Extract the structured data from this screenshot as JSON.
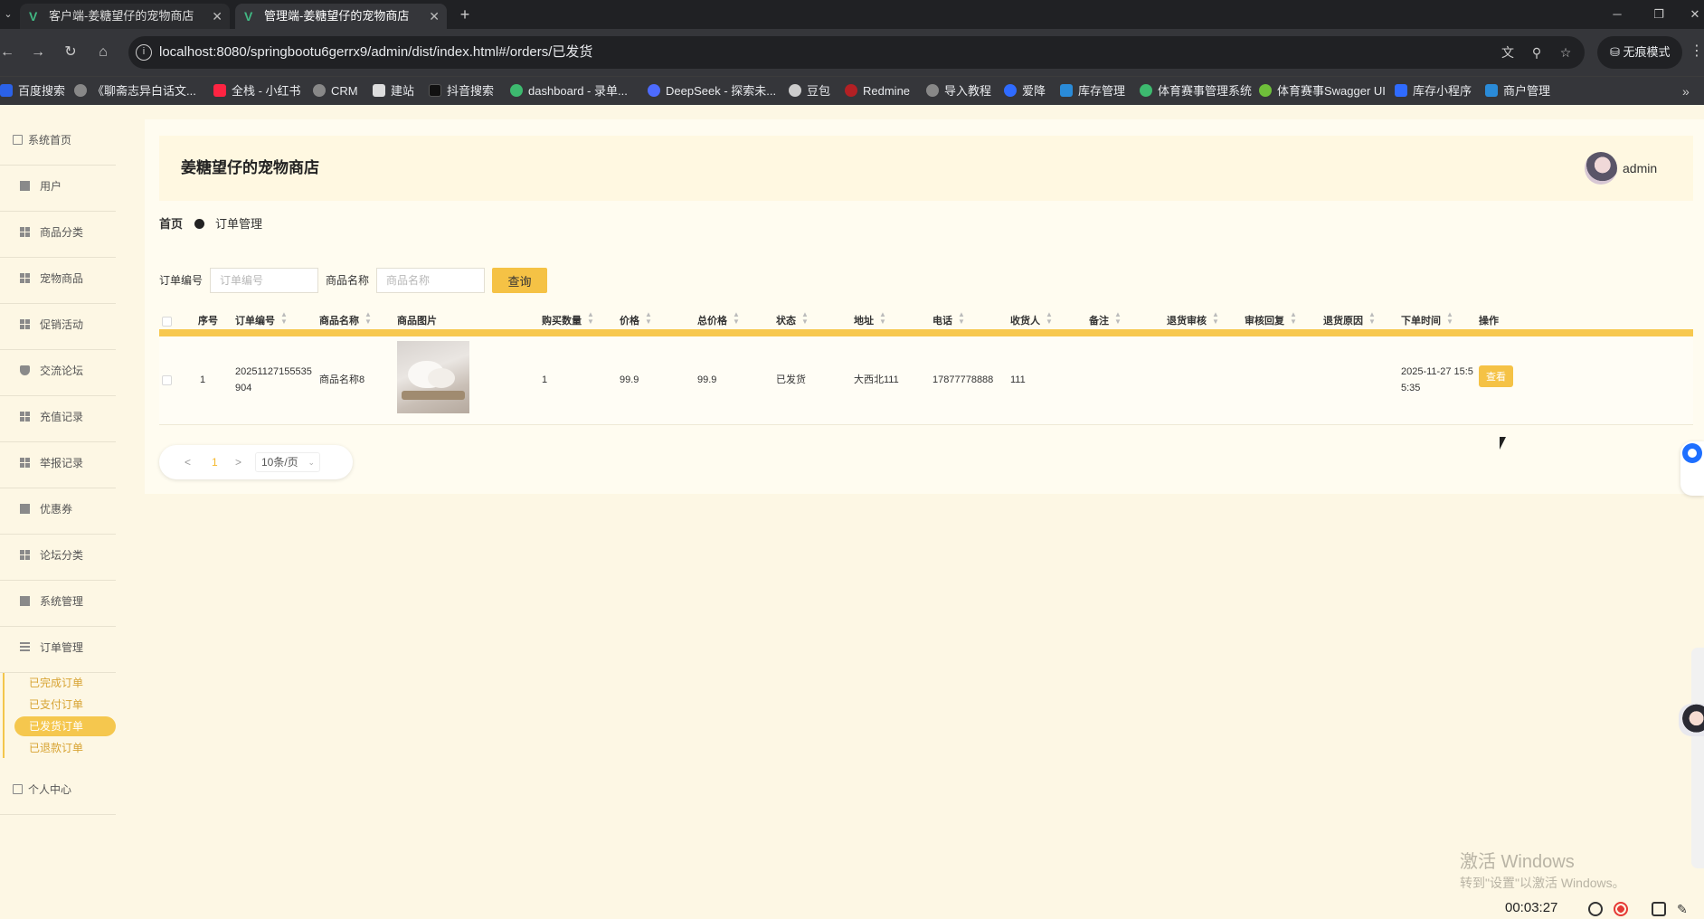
{
  "browser": {
    "tabs": [
      {
        "title": "客户端-姜糖望仔的宠物商店"
      },
      {
        "title": "管理端-姜糖望仔的宠物商店"
      }
    ],
    "url": "localhost:8080/springbootu6gerrx9/admin/dist/index.html#/orders/已发货",
    "incognito_label": "无痕模式",
    "bookmarks": [
      "百度搜索",
      "《聊斋志异白话文...",
      "全栈 - 小红书",
      "CRM",
      "建站",
      "抖音搜索",
      "dashboard - 录单...",
      "DeepSeek - 探索未...",
      "豆包",
      "Redmine",
      "导入教程",
      "爱降",
      "库存管理",
      "体育赛事管理系统",
      "体育赛事Swagger UI",
      "库存小程序",
      "商户管理"
    ]
  },
  "sidebar": {
    "home": "系统首页",
    "items": [
      "用户",
      "商品分类",
      "宠物商品",
      "促销活动",
      "交流论坛",
      "充值记录",
      "举报记录",
      "优惠券",
      "论坛分类",
      "系统管理",
      "订单管理"
    ],
    "order_sub": [
      "已完成订单",
      "已支付订单",
      "已发货订单",
      "已退款订单"
    ],
    "active_sub": "已发货订单",
    "profile": "个人中心"
  },
  "header": {
    "shop_name": "姜糖望仔的宠物商店",
    "username": "admin"
  },
  "breadcrumb": {
    "home": "首页",
    "current": "订单管理"
  },
  "search": {
    "order_no_label": "订单编号",
    "order_no_placeholder": "订单编号",
    "product_label": "商品名称",
    "product_placeholder": "商品名称",
    "query_button": "查询"
  },
  "table": {
    "columns": [
      "序号",
      "订单编号",
      "商品名称",
      "商品图片",
      "购买数量",
      "价格",
      "总价格",
      "状态",
      "地址",
      "电话",
      "收货人",
      "备注",
      "退货审核",
      "审核回复",
      "退货原因",
      "下单时间",
      "操作"
    ],
    "rows": [
      {
        "index": "1",
        "order_no": "20251127155535904",
        "product_name": "商品名称8",
        "quantity": "1",
        "price": "99.9",
        "total": "99.9",
        "status": "已发货",
        "address": "大西北111",
        "phone": "17877778888",
        "receiver": "111",
        "remark": "",
        "return_review": "",
        "review_reply": "",
        "return_reason": "",
        "order_time": "2025-11-27 15:55:35",
        "action": "查看"
      }
    ]
  },
  "pager": {
    "prev": "<",
    "current": "1",
    "next": ">",
    "page_size": "10条/页"
  },
  "watermark": {
    "line1": "激活 Windows",
    "line2": "转到\"设置\"以激活 Windows。"
  },
  "recorder": {
    "time": "00:03:27"
  },
  "colors": {
    "accent": "#f5c245",
    "background": "#fdf7e4"
  }
}
